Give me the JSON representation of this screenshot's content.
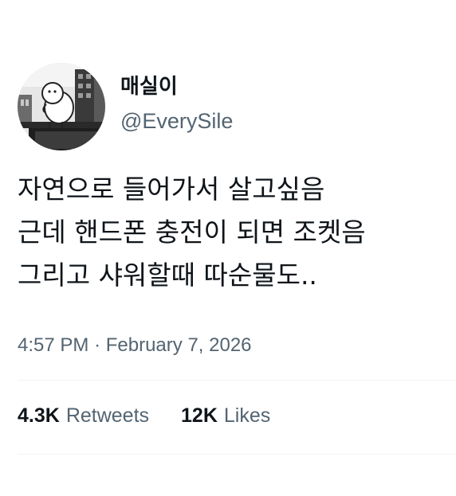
{
  "author": {
    "display_name": "매실이",
    "handle": "@EverySile",
    "avatar_icon": "profile-avatar-illustration"
  },
  "tweet": {
    "lines": [
      "자연으로 들어가서 살고싶음",
      "근데 핸드폰 충전이 되면 조켓음",
      "그리고 샤워할때 따순물도.."
    ],
    "time": "4:57 PM",
    "separator": "·",
    "date": "February 7, 2026"
  },
  "stats": {
    "retweets_count": "4.3K",
    "retweets_label": "Retweets",
    "likes_count": "12K",
    "likes_label": "Likes"
  },
  "colors": {
    "text_primary": "#0f1419",
    "text_secondary": "#536471",
    "background": "#ffffff"
  }
}
